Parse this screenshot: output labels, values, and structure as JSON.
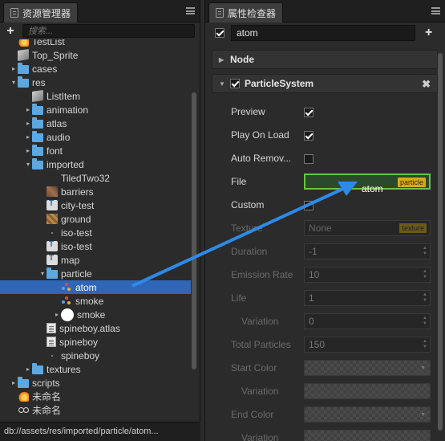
{
  "assets": {
    "tab_title": "资源管理器",
    "search_placeholder": "搜索...",
    "tree": [
      {
        "label": "TestList",
        "icon": "fire",
        "depth": 1,
        "arrow": ""
      },
      {
        "label": "Top_Sprite",
        "icon": "cube",
        "depth": 1,
        "arrow": ""
      },
      {
        "label": "cases",
        "icon": "folder",
        "depth": 1,
        "arrow": "▸"
      },
      {
        "label": "res",
        "icon": "folder",
        "depth": 1,
        "arrow": "▾"
      },
      {
        "label": "ListItem",
        "icon": "cube",
        "depth": 2,
        "arrow": ""
      },
      {
        "label": "animation",
        "icon": "folder",
        "depth": 2,
        "arrow": "▸"
      },
      {
        "label": "atlas",
        "icon": "folder",
        "depth": 2,
        "arrow": "▸"
      },
      {
        "label": "audio",
        "icon": "folder",
        "depth": 2,
        "arrow": "▸"
      },
      {
        "label": "font",
        "icon": "folder",
        "depth": 2,
        "arrow": "▸"
      },
      {
        "label": "imported",
        "icon": "folder",
        "depth": 2,
        "arrow": "▾"
      },
      {
        "label": "TiledTwo32",
        "icon": "blank",
        "depth": 3,
        "arrow": ""
      },
      {
        "label": "barriers",
        "icon": "img1",
        "depth": 3,
        "arrow": ""
      },
      {
        "label": "city-test",
        "icon": "tmx",
        "depth": 3,
        "arrow": ""
      },
      {
        "label": "ground",
        "icon": "img2",
        "depth": 3,
        "arrow": ""
      },
      {
        "label": "iso-test",
        "icon": "faint",
        "depth": 3,
        "arrow": ""
      },
      {
        "label": "iso-test",
        "icon": "tmx",
        "depth": 3,
        "arrow": ""
      },
      {
        "label": "map",
        "icon": "tmx",
        "depth": 3,
        "arrow": ""
      },
      {
        "label": "particle",
        "icon": "folder",
        "depth": 3,
        "arrow": "▾"
      },
      {
        "label": "atom",
        "icon": "dots",
        "depth": 4,
        "arrow": "",
        "selected": true
      },
      {
        "label": "smoke",
        "icon": "dots",
        "depth": 4,
        "arrow": ""
      },
      {
        "label": "smoke",
        "icon": "ball",
        "depth": 4,
        "arrow": "▸"
      },
      {
        "label": "spineboy.atlas",
        "icon": "doc",
        "depth": 3,
        "arrow": ""
      },
      {
        "label": "spineboy",
        "icon": "doc",
        "depth": 3,
        "arrow": ""
      },
      {
        "label": "spineboy",
        "icon": "faint",
        "depth": 3,
        "arrow": ""
      },
      {
        "label": "textures",
        "icon": "folder",
        "depth": 2,
        "arrow": "▸"
      },
      {
        "label": "scripts",
        "icon": "folder",
        "depth": 1,
        "arrow": "▸"
      },
      {
        "label": "未命名",
        "icon": "fire",
        "depth": 1,
        "arrow": ""
      },
      {
        "label": "未命名",
        "icon": "spine",
        "depth": 1,
        "arrow": ""
      }
    ],
    "status_path": "db://assets/res/imported/particle/atom..."
  },
  "inspector": {
    "tab_title": "属性检查器",
    "node_name": "atom",
    "node_section": "Node",
    "component_section": "ParticleSystem",
    "drag_label": "atom",
    "props": {
      "preview": {
        "label": "Preview",
        "checked": true
      },
      "play_on_load": {
        "label": "Play On Load",
        "checked": true
      },
      "auto_remove": {
        "label": "Auto Remov...",
        "checked": false
      },
      "file": {
        "label": "File",
        "value": "",
        "tag": "particle"
      },
      "custom": {
        "label": "Custom",
        "checked": false
      },
      "texture": {
        "label": "Texture",
        "value": "None",
        "tag": "texture"
      },
      "duration": {
        "label": "Duration",
        "value": "-1"
      },
      "emission_rate": {
        "label": "Emission Rate",
        "value": "10"
      },
      "life": {
        "label": "Life",
        "value": "1"
      },
      "life_variation": {
        "label": "Variation",
        "value": "0"
      },
      "total_particles": {
        "label": "Total Particles",
        "value": "150"
      },
      "start_color": {
        "label": "Start Color"
      },
      "start_color_variation": {
        "label": "Variation"
      },
      "end_color": {
        "label": "End Color"
      },
      "end_color_variation": {
        "label": "Variation"
      }
    }
  },
  "colors": {
    "selection": "#3066b8",
    "folder": "#5ea8e0",
    "drop_target_border": "#6ac24a",
    "drag_arrow": "#2d8ae8",
    "asset_tag": "#d8a817"
  }
}
